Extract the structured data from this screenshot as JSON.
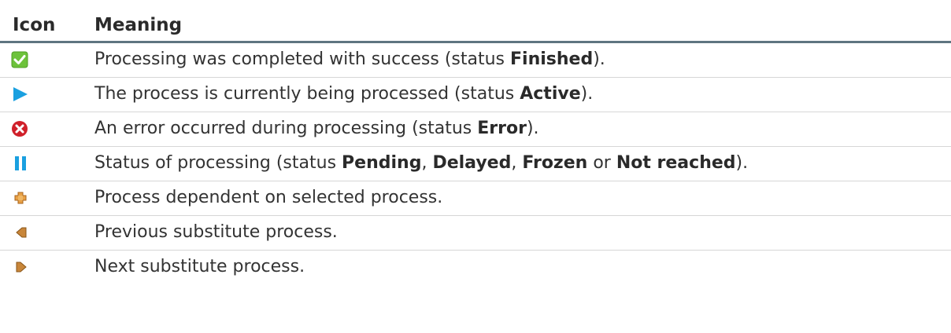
{
  "header": {
    "icon_col": "Icon",
    "meaning_col": "Meaning"
  },
  "rows": [
    {
      "icon": "green-checkmark-icon",
      "text_pre": "Processing was completed with success (status ",
      "bold1": "Finished",
      "text_post": ")."
    },
    {
      "icon": "blue-play-icon",
      "text_pre": "The process is currently being processed (status ",
      "bold1": "Active",
      "text_post": ")."
    },
    {
      "icon": "red-error-icon",
      "text_pre": "An error occurred during processing (status ",
      "bold1": "Error",
      "text_post": ")."
    },
    {
      "icon": "blue-pause-icon",
      "text_pre": "Status of processing (status ",
      "bold1": "Pending",
      "sep1": ", ",
      "bold2": "Delayed",
      "sep2": ", ",
      "bold3": "Frozen",
      "sep3": " or ",
      "bold4": "Not reached",
      "text_post": ")."
    },
    {
      "icon": "orange-plus-icon",
      "text": "Process dependent on selected process."
    },
    {
      "icon": "previous-arrow-icon",
      "text": "Previous substitute process."
    },
    {
      "icon": "next-arrow-icon",
      "text": "Next substitute process."
    }
  ],
  "colors": {
    "header_rule": "#5e7580",
    "row_rule": "#d6d6d6",
    "success": "#6dc23b",
    "active": "#1aa0e0",
    "error": "#d0202a",
    "substitute": "#c8863a"
  }
}
